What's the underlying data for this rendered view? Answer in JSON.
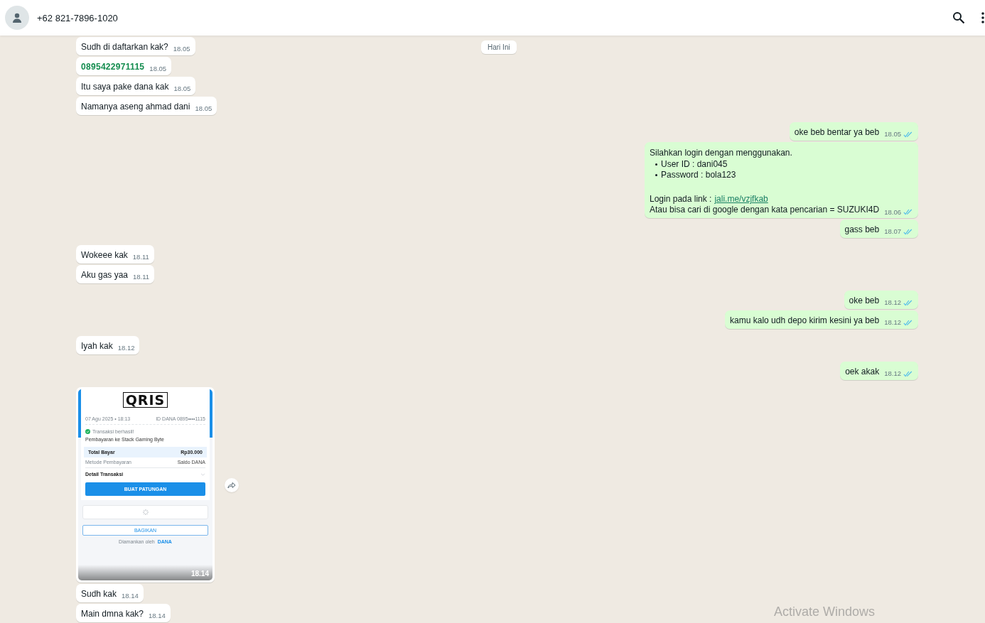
{
  "header": {
    "contact": "+62 821-7896-1020"
  },
  "date_chip": "Hari Ini",
  "messages": [
    {
      "outgoing": false,
      "kind": "text",
      "text": "Sudh di daftarkan kak?",
      "time": "18.05"
    },
    {
      "outgoing": false,
      "kind": "phone",
      "text": "0895422971115",
      "time": "18.05"
    },
    {
      "outgoing": false,
      "kind": "text",
      "text": "Itu saya pake dana kak",
      "time": "18.05"
    },
    {
      "outgoing": false,
      "kind": "text",
      "text": "Namanya aseng ahmad dani",
      "time": "18.05"
    },
    {
      "outgoing": true,
      "kind": "text",
      "text": "oke beb bentar ya beb",
      "time": "18.05",
      "read": true
    },
    {
      "outgoing": true,
      "kind": "formatted",
      "intro": "Silahkan login dengan menggunakan.",
      "items": [
        "User ID : dani045",
        "Password : bola123"
      ],
      "link_label": "Login pada link :",
      "link": "jali.me/vzjfkab",
      "footer": "Atau bisa cari di google dengan kata pencarian = SUZUKI4D",
      "time": "18.06",
      "read": true
    },
    {
      "outgoing": true,
      "kind": "text",
      "text": "gass beb",
      "time": "18.07",
      "read": true
    },
    {
      "outgoing": false,
      "kind": "text",
      "text": "Wokeee kak",
      "time": "18.11"
    },
    {
      "outgoing": false,
      "kind": "text",
      "text": "Aku gas yaa",
      "time": "18.11"
    },
    {
      "outgoing": true,
      "kind": "text",
      "text": "oke beb",
      "time": "18.12",
      "read": true
    },
    {
      "outgoing": true,
      "kind": "text",
      "text": "kamu kalo udh depo kirim kesini ya beb",
      "time": "18.12",
      "read": true
    },
    {
      "outgoing": false,
      "kind": "text",
      "text": "Iyah kak",
      "time": "18.12"
    },
    {
      "outgoing": true,
      "kind": "text",
      "text": "oek akak",
      "time": "18.12",
      "read": true
    },
    {
      "outgoing": false,
      "kind": "image",
      "time": "18.14",
      "receipt": {
        "logo": "QRIS",
        "date": "07 Agu 2025 • 18:13",
        "account": "ID DANA 0895••••1115",
        "status": "Transaksi berhasil!",
        "merchant": "Pembayaran ke Stack Gaming Byte",
        "total_label": "Total Bayar",
        "total": "Rp30.000",
        "method_label": "Metode Pembayaran",
        "method": "Saldo DANA",
        "details_label": "Detail Transaksi",
        "primary_button": "BUAT PATUNGAN",
        "share_button": "BAGIKAN",
        "footer": "Diamankan oleh",
        "footer_brand": "DANA"
      }
    },
    {
      "outgoing": false,
      "kind": "text",
      "text": "Sudh kak",
      "time": "18.14"
    },
    {
      "outgoing": false,
      "kind": "text",
      "text": "Main dmna kak?",
      "time": "18.14"
    }
  ],
  "os_notice": "Activate Windows"
}
